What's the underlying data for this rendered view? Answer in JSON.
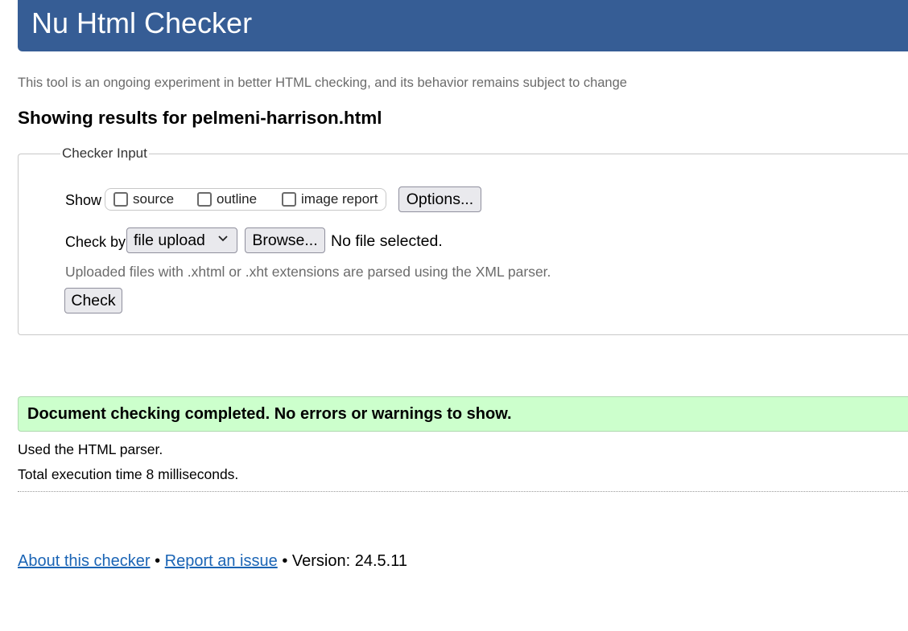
{
  "header": {
    "title": "Nu Html Checker"
  },
  "subtitle": "This tool is an ongoing experiment in better HTML checking, and its behavior remains subject to change",
  "results_heading": "Showing results for pelmeni-harrison.html",
  "checker_input": {
    "legend": "Checker Input",
    "show_label": "Show",
    "options": [
      {
        "label": "source",
        "checked": false
      },
      {
        "label": "outline",
        "checked": false
      },
      {
        "label": "image report",
        "checked": false
      }
    ],
    "options_button": "Options...",
    "check_by_label": "Check by",
    "check_by_selected": "file upload",
    "browse_button": "Browse...",
    "file_status": "No file selected.",
    "upload_note": "Uploaded files with .xhtml or .xht extensions are parsed using the XML parser.",
    "check_button": "Check"
  },
  "result": {
    "message": "Document checking completed. No errors or warnings to show.",
    "parser_info": "Used the HTML parser.",
    "execution_time": "Total execution time 8 milliseconds."
  },
  "footer": {
    "about_link": "About this checker",
    "separator": "•",
    "report_link": "Report an issue",
    "version": "Version: 24.5.11"
  },
  "colors": {
    "header_bg": "#365d95",
    "success_bg": "#ccffcc",
    "link": "#1a64b5"
  }
}
